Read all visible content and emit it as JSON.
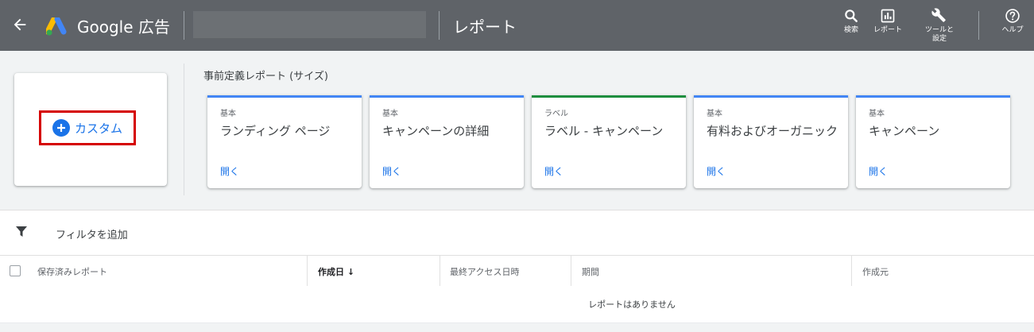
{
  "header": {
    "brand": "Google 広告",
    "page_title": "レポート",
    "tools": [
      {
        "label": "検索",
        "icon": "search-icon"
      },
      {
        "label": "レポート",
        "icon": "report-icon"
      },
      {
        "label": "ツールと設定",
        "icon": "wrench-icon"
      },
      {
        "label": "ヘルプ",
        "icon": "help-icon"
      }
    ]
  },
  "custom": {
    "label": "カスタム"
  },
  "predefined": {
    "title": "事前定義レポート (サイズ)",
    "cards": [
      {
        "category": "基本",
        "name": "ランディング ページ",
        "open": "開く"
      },
      {
        "category": "基本",
        "name": "キャンペーンの詳細",
        "open": "開く"
      },
      {
        "category": "ラベル",
        "name": "ラベル - キャンペーン",
        "open": "開く"
      },
      {
        "category": "基本",
        "name": "有料およびオーガニック",
        "open": "開く"
      },
      {
        "category": "基本",
        "name": "キャンペーン",
        "open": "開く"
      }
    ]
  },
  "filter": {
    "label": "フィルタを追加"
  },
  "table": {
    "columns": [
      "保存済みレポート",
      "作成日 ↓",
      "最終アクセス日時",
      "期間",
      "作成元"
    ],
    "empty_message": "レポートはありません"
  },
  "colors": {
    "topbar": "#5f6368",
    "accent": "#1a73e8",
    "highlight_border": "#d50000",
    "card_blue": "#4285f4",
    "card_green": "#1e8e3e"
  }
}
